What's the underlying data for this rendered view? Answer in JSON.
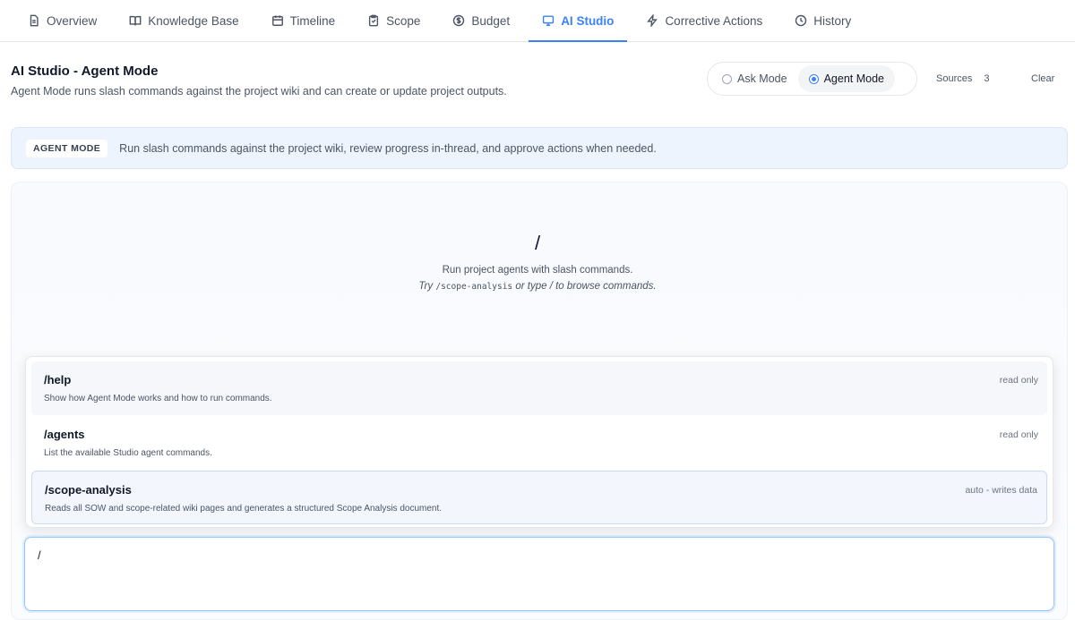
{
  "tabs": [
    {
      "id": "overview",
      "label": "Overview",
      "icon": "document-icon",
      "active": false
    },
    {
      "id": "knowledge-base",
      "label": "Knowledge Base",
      "icon": "book-icon",
      "active": false
    },
    {
      "id": "timeline",
      "label": "Timeline",
      "icon": "calendar-icon",
      "active": false
    },
    {
      "id": "scope",
      "label": "Scope",
      "icon": "clipboard-icon",
      "active": false
    },
    {
      "id": "budget",
      "label": "Budget",
      "icon": "dollar-circle-icon",
      "active": false
    },
    {
      "id": "ai-studio",
      "label": "AI Studio",
      "icon": "monitor-icon",
      "active": true
    },
    {
      "id": "corrective-actions",
      "label": "Corrective Actions",
      "icon": "bolt-icon",
      "active": false
    },
    {
      "id": "history",
      "label": "History",
      "icon": "clock-icon",
      "active": false
    }
  ],
  "header": {
    "title": "AI Studio - Agent Mode",
    "description": "Agent Mode runs slash commands against the project wiki and can create or update project outputs."
  },
  "mode_toggle": {
    "ask_label": "Ask Mode",
    "agent_label": "Agent Mode",
    "selected": "agent"
  },
  "sources": {
    "label": "Sources",
    "count": "3"
  },
  "clear_label": "Clear",
  "banner": {
    "badge": "AGENT MODE",
    "text": "Run slash commands against the project wiki, review progress in-thread, and approve actions when needed."
  },
  "empty_state": {
    "glyph": "/",
    "line1": "Run project agents with slash commands.",
    "line2_prefix": "Try",
    "line2_code": "/scope-analysis",
    "line2_suffix": "or type / to browse commands."
  },
  "commands": [
    {
      "name": "/help",
      "description": "Show how Agent Mode works and how to run commands.",
      "tag": "read only"
    },
    {
      "name": "/agents",
      "description": "List the available Studio agent commands.",
      "tag": "read only"
    },
    {
      "name": "/scope-analysis",
      "description": "Reads all SOW and scope-related wiki pages and generates a structured Scope Analysis document.",
      "tag": "auto - writes data"
    }
  ],
  "composer": {
    "value": "/"
  },
  "colors": {
    "accent": "#3b82f6",
    "banner_bg": "#eef4fd"
  }
}
